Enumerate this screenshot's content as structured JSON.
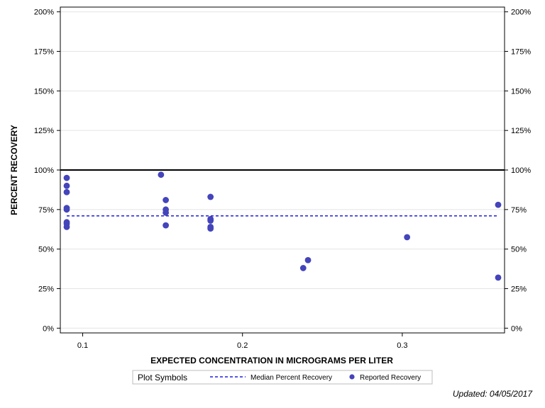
{
  "chart_data": {
    "type": "scatter",
    "xlabel": "EXPECTED CONCENTRATION IN MICROGRAMS PER LITER",
    "ylabel": "PERCENT RECOVERY",
    "xlim": [
      0.086,
      0.364
    ],
    "ylim": [
      -3,
      203
    ],
    "x_ticks": [
      0.1,
      0.2,
      0.3
    ],
    "x_tick_labels": [
      "0.1",
      "0.2",
      "0.3"
    ],
    "y_ticks": [
      0,
      25,
      50,
      75,
      100,
      125,
      150,
      175,
      200
    ],
    "y_tick_labels": [
      "0%",
      "25%",
      "50%",
      "75%",
      "100%",
      "125%",
      "150%",
      "175%",
      "200%"
    ],
    "grid": "horizontal",
    "reference_line": {
      "y": 100,
      "color": "#000000"
    },
    "median_line": {
      "name": "Median Percent Recovery",
      "y": 71,
      "color": "#1f1fe0"
    },
    "series": [
      {
        "name": "Reported Recovery",
        "color": "#4444bb",
        "points": [
          {
            "x": 0.09,
            "y": 95
          },
          {
            "x": 0.09,
            "y": 90
          },
          {
            "x": 0.09,
            "y": 86
          },
          {
            "x": 0.09,
            "y": 76
          },
          {
            "x": 0.09,
            "y": 75
          },
          {
            "x": 0.09,
            "y": 67
          },
          {
            "x": 0.09,
            "y": 66
          },
          {
            "x": 0.09,
            "y": 64
          },
          {
            "x": 0.149,
            "y": 97
          },
          {
            "x": 0.152,
            "y": 81
          },
          {
            "x": 0.152,
            "y": 75
          },
          {
            "x": 0.152,
            "y": 73
          },
          {
            "x": 0.152,
            "y": 65
          },
          {
            "x": 0.18,
            "y": 83
          },
          {
            "x": 0.18,
            "y": 69
          },
          {
            "x": 0.18,
            "y": 68
          },
          {
            "x": 0.18,
            "y": 64
          },
          {
            "x": 0.18,
            "y": 63
          },
          {
            "x": 0.238,
            "y": 38
          },
          {
            "x": 0.241,
            "y": 43
          },
          {
            "x": 0.303,
            "y": 57.5
          },
          {
            "x": 0.36,
            "y": 78
          },
          {
            "x": 0.36,
            "y": 32
          }
        ]
      }
    ],
    "legend": {
      "title": "Plot Symbols",
      "placement": "bottom-center",
      "items": [
        "Median Percent Recovery",
        "Reported Recovery"
      ]
    },
    "footer": "Updated: 04/05/2017"
  }
}
